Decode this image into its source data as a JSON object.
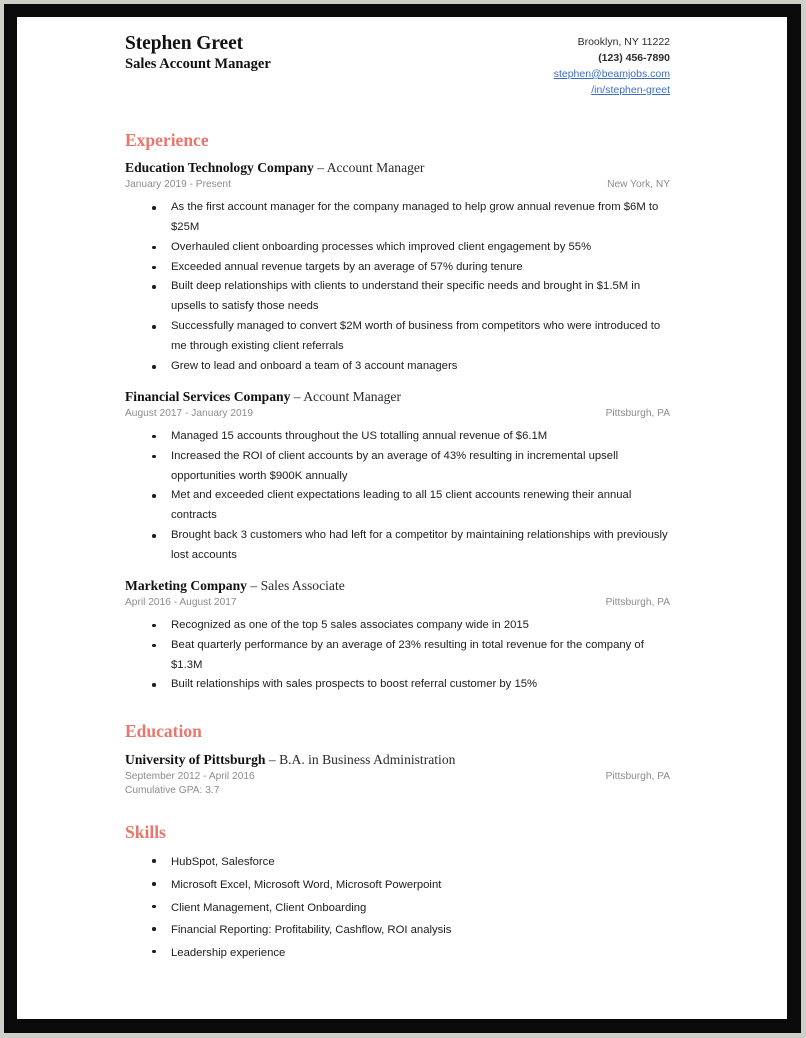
{
  "document": {
    "type": "resume",
    "accent_color": "#e8776c",
    "link_color": "#3c6fc4"
  },
  "header": {
    "full_name": "Stephen Greet",
    "job_title": "Sales Account Manager",
    "contact": {
      "location": "Brooklyn, NY 11222",
      "phone": "(123) 456-7890",
      "email": "stephen@beamjobs.com",
      "linkedin": "/in/stephen-greet"
    }
  },
  "sections": {
    "experience": {
      "heading": "Experience",
      "entries": [
        {
          "organization": "Education Technology Company",
          "separator": " – ",
          "role": "Account Manager",
          "dates": "January 2019 - Present",
          "location": "New York, NY",
          "bullets": [
            "As the first account manager for the company managed to help grow annual revenue from $6M to $25M",
            "Overhauled client onboarding processes which improved client engagement by 55%",
            "Exceeded annual revenue targets by an average of 57% during tenure",
            "Built deep relationships with clients to understand their specific needs and brought in $1.5M in upsells to satisfy those needs",
            "Successfully managed to convert $2M worth of business from competitors who were introduced to me through existing client referrals",
            "Grew to lead and onboard a team of 3 account managers"
          ]
        },
        {
          "organization": "Financial Services Company",
          "separator": " – ",
          "role": "Account Manager",
          "dates": "August 2017 - January 2019",
          "location": "Pittsburgh, PA",
          "bullets": [
            "Managed 15 accounts throughout the US totalling annual revenue of $6.1M",
            "Increased the ROI of client accounts by an average of 43% resulting in incremental upsell opportunities worth $900K annually",
            "Met and  exceeded client expectations leading to all 15 client accounts renewing their annual contracts",
            "Brought back 3 customers who had left for a competitor by maintaining relationships with previously lost accounts"
          ]
        },
        {
          "organization": "Marketing Company",
          "separator": " – ",
          "role": "Sales Associate",
          "dates": "April 2016 - August 2017",
          "location": "Pittsburgh, PA",
          "bullets": [
            "Recognized as one of the top 5 sales associates company wide in 2015",
            "Beat quarterly performance by an average of 23% resulting in total revenue for the company of $1.3M",
            "Built relationships with sales prospects to boost referral customer by 15%"
          ]
        }
      ]
    },
    "education": {
      "heading": "Education",
      "entries": [
        {
          "organization": "University of Pittsburgh",
          "separator": " – ",
          "role": "B.A. in Business Administration",
          "dates": "September 2012 - April 2016",
          "location": "Pittsburgh, PA",
          "extra": "Cumulative GPA: 3.7"
        }
      ]
    },
    "skills": {
      "heading": "Skills",
      "items": [
        "HubSpot, Salesforce",
        "Microsoft Excel, Microsoft Word, Microsoft Powerpoint",
        "Client Management, Client Onboarding",
        "Financial Reporting: Profitability, Cashflow, ROI analysis",
        "Leadership experience"
      ]
    }
  }
}
